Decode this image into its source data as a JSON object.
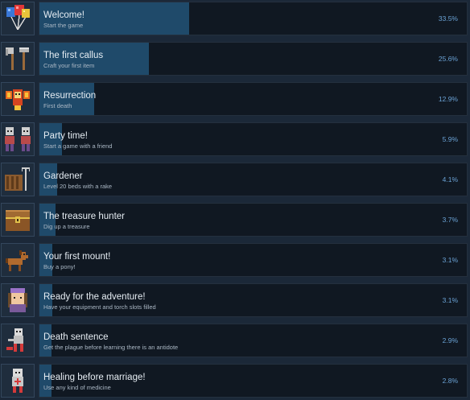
{
  "achievements": [
    {
      "title": "Welcome!",
      "description": "Start the game",
      "percent": "33.5%",
      "fraction": 0.335,
      "icon": "balloons-icon"
    },
    {
      "title": "The first callus",
      "description": "Craft your first item",
      "percent": "25.6%",
      "fraction": 0.256,
      "icon": "axe-and-hammer-icon"
    },
    {
      "title": "Resurrection",
      "description": "First death",
      "percent": "12.9%",
      "fraction": 0.129,
      "icon": "phoenix-icon"
    },
    {
      "title": "Party time!",
      "description": "Start a game with a friend",
      "percent": "5.9%",
      "fraction": 0.059,
      "icon": "two-players-icon"
    },
    {
      "title": "Gardener",
      "description": "Level 20 beds with a rake",
      "percent": "4.1%",
      "fraction": 0.041,
      "icon": "rake-and-bed-icon"
    },
    {
      "title": "The treasure hunter",
      "description": "Dig up a treasure",
      "percent": "3.7%",
      "fraction": 0.037,
      "icon": "treasure-chest-icon"
    },
    {
      "title": "Your first mount!",
      "description": "Buy a pony!",
      "percent": "3.1%",
      "fraction": 0.031,
      "icon": "pony-icon"
    },
    {
      "title": "Ready for the adventure!",
      "description": "Have your equipment and torch slots filled",
      "percent": "3.1%",
      "fraction": 0.031,
      "icon": "adventurer-icon"
    },
    {
      "title": "Death sentence",
      "description": "Get the plague before learning there is an antidote",
      "percent": "2.9%",
      "fraction": 0.029,
      "icon": "plague-skeleton-icon"
    },
    {
      "title": "Healing before marriage!",
      "description": "Use any kind of medicine",
      "percent": "2.8%",
      "fraction": 0.028,
      "icon": "healer-icon"
    }
  ],
  "colors": {
    "background": "#1b2838",
    "panel": "#101822",
    "progress_fill": "#1f4a6a",
    "percent_text": "#6ba3d6"
  }
}
